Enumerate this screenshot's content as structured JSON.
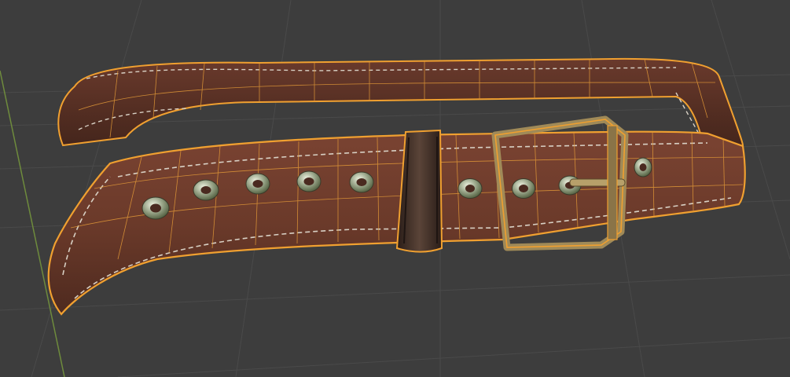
{
  "viewport": {
    "mode": "3d-viewport",
    "shading": "material-preview",
    "background_color": "#3d3d3d",
    "grid_color": "#4a4a4a",
    "axis_y_color": "#6e8b3d"
  },
  "selected_object": {
    "name": "",
    "object_type": "mesh",
    "description_icon": "belt-mesh",
    "selected": true,
    "wireframe_overlay": true,
    "outline_color": "#f0a030",
    "wire_color": "#e39a38"
  },
  "belt": {
    "leather_color": "#6b3a2a",
    "stitch_color": "#d8d0c4",
    "eyelet_count": 10,
    "metal_color": "#b9bfa8",
    "buckle_color": "#a08a58",
    "loop_color": "#3a2a22"
  }
}
